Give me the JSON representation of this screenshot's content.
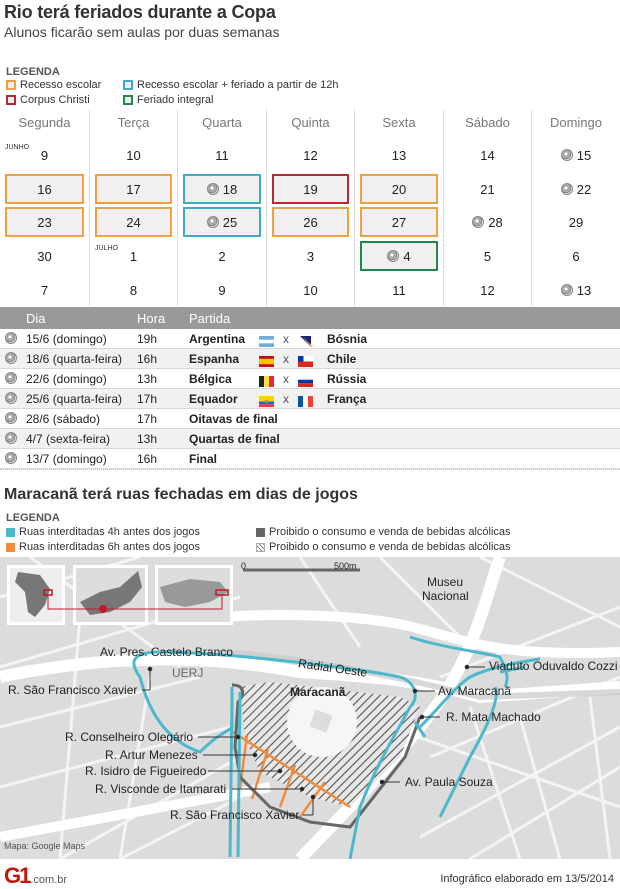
{
  "header": {
    "title": "Rio terá feriados durante a Copa",
    "subtitle": "Alunos ficarão sem aulas por duas semanas"
  },
  "legend1": {
    "title": "LEGENDA",
    "items": [
      {
        "label": "Recesso escolar",
        "color": "#f0a040"
      },
      {
        "label": "Recesso escolar + feriado a partir de 12h",
        "color": "#3fa9c9"
      },
      {
        "label": "Corpus Christi",
        "color": "#b22a35"
      },
      {
        "label": "Feriado integral",
        "color": "#1f8a4c"
      }
    ]
  },
  "calendar": {
    "days": [
      "Segunda",
      "Terça",
      "Quarta",
      "Quinta",
      "Sexta",
      "Sábado",
      "Domingo"
    ],
    "month_labels": {
      "june": "JUNHO",
      "july": "JULHO"
    },
    "weeks": [
      [
        {
          "d": "9",
          "month": "JUNHO"
        },
        {
          "d": "10"
        },
        {
          "d": "11"
        },
        {
          "d": "12"
        },
        {
          "d": "13"
        },
        {
          "d": "14"
        },
        {
          "d": "15",
          "ball": true
        }
      ],
      [
        {
          "d": "16",
          "type": "recesso"
        },
        {
          "d": "17",
          "type": "recesso"
        },
        {
          "d": "18",
          "type": "recesso12h",
          "ball": true
        },
        {
          "d": "19",
          "type": "corpus"
        },
        {
          "d": "20",
          "type": "recesso"
        },
        {
          "d": "21"
        },
        {
          "d": "22",
          "ball": true
        }
      ],
      [
        {
          "d": "23",
          "type": "recesso"
        },
        {
          "d": "24",
          "type": "recesso"
        },
        {
          "d": "25",
          "type": "recesso12h",
          "ball": true
        },
        {
          "d": "26",
          "type": "recesso"
        },
        {
          "d": "27",
          "type": "recesso"
        },
        {
          "d": "28",
          "ball": true
        },
        {
          "d": "29"
        }
      ],
      [
        {
          "d": "30"
        },
        {
          "d": "1",
          "month": "JULHO"
        },
        {
          "d": "2"
        },
        {
          "d": "3"
        },
        {
          "d": "4",
          "type": "integral",
          "ball": true
        },
        {
          "d": "5"
        },
        {
          "d": "6"
        }
      ],
      [
        {
          "d": "7"
        },
        {
          "d": "8"
        },
        {
          "d": "9"
        },
        {
          "d": "10"
        },
        {
          "d": "11"
        },
        {
          "d": "12"
        },
        {
          "d": "13",
          "ball": true
        }
      ]
    ],
    "type_colors": {
      "recesso": "#f0a040",
      "recesso12h": "#3fa9c9",
      "corpus": "#b22a35",
      "integral": "#1f8a4c"
    }
  },
  "matches": {
    "headers": {
      "dia": "Dia",
      "hora": "Hora",
      "partida": "Partida"
    },
    "vs": "x",
    "rows": [
      {
        "dia": "15/6 (domingo)",
        "hora": "19h",
        "home": "Argentina",
        "away": "Bósnia",
        "home_flag": "argentina-flag",
        "away_flag": "bosnia-flag"
      },
      {
        "dia": "18/6 (quarta-feira)",
        "hora": "16h",
        "home": "Espanha",
        "away": "Chile",
        "home_flag": "spain-flag",
        "away_flag": "chile-flag"
      },
      {
        "dia": "22/6 (domingo)",
        "hora": "13h",
        "home": "Bélgica",
        "away": "Rússia",
        "home_flag": "belgium-flag",
        "away_flag": "russia-flag"
      },
      {
        "dia": "25/6 (quarta-feira)",
        "hora": "17h",
        "home": "Equador",
        "away": "França",
        "home_flag": "ecuador-flag",
        "away_flag": "france-flag"
      },
      {
        "dia": "28/6 (sábado)",
        "hora": "17h",
        "stage": "Oitavas de final"
      },
      {
        "dia": "4/7 (sexta-feira)",
        "hora": "13h",
        "stage": "Quartas de final"
      },
      {
        "dia": "13/7 (domingo)",
        "hora": "16h",
        "stage": "Final"
      }
    ]
  },
  "section2": {
    "title": "Maracanã terá ruas fechadas em dias de jogos",
    "legend_title": "LEGENDA",
    "legend": [
      {
        "label": "Ruas interditadas 4h antes dos jogos",
        "color": "#4bb8cc"
      },
      {
        "label": "Ruas interditadas 6h antes dos jogos",
        "color": "#f08c3c"
      },
      {
        "label": "Proibido o consumo e venda de bebidas alcólicas",
        "color": "#666666"
      },
      {
        "label": "Proibido o consumo e venda de bebidas alcólicas",
        "color": "hatched"
      }
    ]
  },
  "map": {
    "scale": {
      "start": "0",
      "end": "500m"
    },
    "labels": {
      "museu": "Museu",
      "nacional": "Nacional",
      "castelo_branco": "Av. Pres. Castelo Branco",
      "radial_oeste": "Radial Oeste",
      "viaduto": "Viaduto Oduvaldo Cozzi",
      "uerj": "UERJ",
      "maracana": "Maracanã",
      "sao_francisco_1": "R. São Francisco Xavier",
      "av_maracana": "Av. Maracanã",
      "mata_machado": "R. Mata Machado",
      "conselheiro": "R. Conselheiro Olegário",
      "artur": "R. Artur Menezes",
      "paula_souza": "Av. Paula Souza",
      "isidro": "R. Isidro de Figueiredo",
      "visconde": "R. Visconde de Itamarati",
      "sao_francisco_2": "R. São Francisco Xavier"
    },
    "credit": "Mapa: Google Maps"
  },
  "footer": {
    "logo": "G1",
    "domain": ".com.br",
    "note": "Infográfico elaborado em 13/5/2014"
  }
}
